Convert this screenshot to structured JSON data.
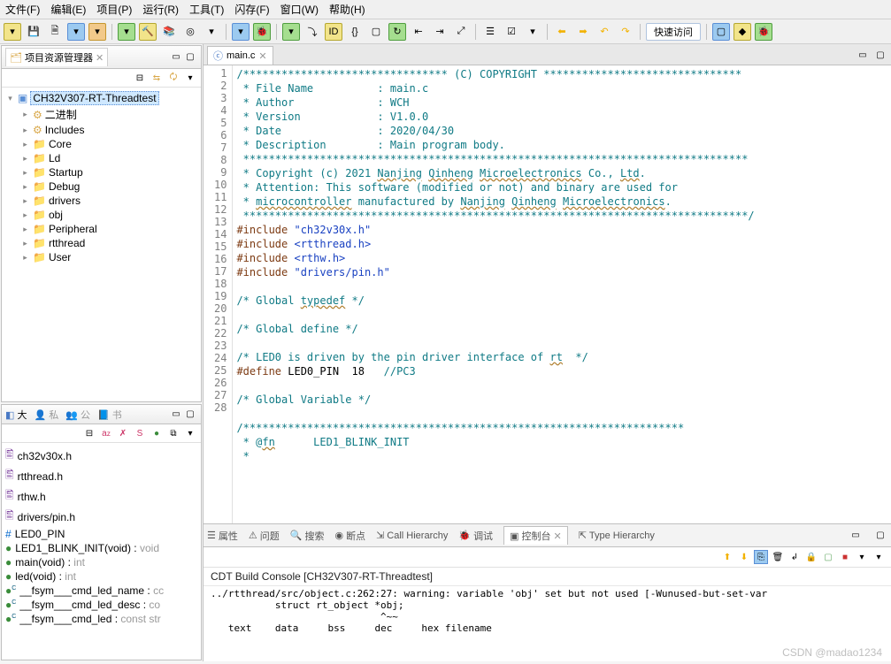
{
  "menubar": [
    "文件(F)",
    "编辑(E)",
    "项目(P)",
    "运行(R)",
    "工具(T)",
    "闪存(F)",
    "窗口(W)",
    "帮助(H)"
  ],
  "toolbar_fastaccess": "快速访问",
  "project_explorer": {
    "title": "项目资源管理器",
    "project_name": "CH32V307-RT-Threadtest",
    "folders": [
      "二进制",
      "Includes",
      "Core",
      "Ld",
      "Startup",
      "Debug",
      "drivers",
      "obj",
      "Peripheral",
      "rtthread",
      "User"
    ]
  },
  "outline_panel": {
    "tabs": [
      "大",
      "私",
      "公",
      "书"
    ],
    "items": [
      {
        "icon": "h",
        "label": "ch32v30x.h"
      },
      {
        "icon": "h",
        "label": "rtthread.h"
      },
      {
        "icon": "h",
        "label": "rthw.h"
      },
      {
        "icon": "h",
        "label": "drivers/pin.h"
      },
      {
        "icon": "#",
        "label": "LED0_PIN"
      },
      {
        "icon": "o",
        "label": "LED1_BLINK_INIT(void) : void",
        "dim": true
      },
      {
        "icon": "o",
        "label": "main(void) : int",
        "dim": true
      },
      {
        "icon": "o",
        "label": "led(void) : int",
        "dim": true
      },
      {
        "icon": "oc",
        "label": "__fsym___cmd_led_name : cc",
        "dim": true
      },
      {
        "icon": "oc",
        "label": "__fsym___cmd_led_desc : co",
        "dim": true
      },
      {
        "icon": "oc",
        "label": "__fsym___cmd_led : const str",
        "dim": true
      }
    ]
  },
  "editor": {
    "file_tab": "main.c",
    "lines": [
      {
        "n": 1,
        "html": "<span class='c-comment'>/******************************** (C) COPYRIGHT *******************************</span>"
      },
      {
        "n": 2,
        "html": "<span class='c-comment'> * File Name          : main.c</span>"
      },
      {
        "n": 3,
        "html": "<span class='c-comment'> * Author             : WCH</span>"
      },
      {
        "n": 4,
        "html": "<span class='c-comment'> * Version            : V1.0.0</span>"
      },
      {
        "n": 5,
        "html": "<span class='c-comment'> * Date               : 2020/04/30</span>"
      },
      {
        "n": 6,
        "html": "<span class='c-comment'> * Description        : Main program body.</span>"
      },
      {
        "n": 7,
        "html": "<span class='c-comment'> *******************************************************************************</span>"
      },
      {
        "n": 8,
        "html": "<span class='c-comment'> * Copyright (c) 2021 <span class='c-wavy'>Nanjing</span> <span class='c-wavy'>Qinheng</span> <span class='c-wavy'>Microelectronics</span> Co., <span class='c-wavy'>Ltd</span>.</span>"
      },
      {
        "n": 9,
        "html": "<span class='c-comment'> * Attention: This software (modified or not) and binary are used for</span>"
      },
      {
        "n": 10,
        "html": "<span class='c-comment'> * <span class='c-wavy'>microcontroller</span> manufactured by <span class='c-wavy'>Nanjing</span> <span class='c-wavy'>Qinheng</span> <span class='c-wavy'>Microelectronics</span>.</span>"
      },
      {
        "n": 11,
        "html": "<span class='c-comment'> *******************************************************************************/</span>"
      },
      {
        "n": 12,
        "html": "<span class='c-pp'>#include</span> <span class='c-str'>\"ch32v30x.h\"</span>"
      },
      {
        "n": 13,
        "html": "<span class='c-pp'>#include</span> <span class='c-str'>&lt;rtthread.h&gt;</span>"
      },
      {
        "n": 14,
        "html": "<span class='c-pp'>#include</span> <span class='c-str'>&lt;rthw.h&gt;</span>"
      },
      {
        "n": 15,
        "html": "<span class='c-pp'>#include</span> <span class='c-str'>\"drivers/pin.h\"</span>"
      },
      {
        "n": 16,
        "html": ""
      },
      {
        "n": 17,
        "html": "<span class='c-comment'>/* Global <span class='c-wavy'>typedef</span> */</span>"
      },
      {
        "n": 18,
        "html": ""
      },
      {
        "n": 19,
        "html": "<span class='c-comment'>/* Global define */</span>"
      },
      {
        "n": 20,
        "html": ""
      },
      {
        "n": 21,
        "html": "<span class='c-comment'>/* LED0 is driven by the pin driver interface of <span class='c-wavy'>rt</span>  */</span>"
      },
      {
        "n": 22,
        "html": "<span class='c-pp'>#define</span> LED0_PIN  18   <span class='c-comment'>//PC3</span>"
      },
      {
        "n": 23,
        "html": ""
      },
      {
        "n": 24,
        "html": "<span class='c-comment'>/* Global Variable */</span>"
      },
      {
        "n": 25,
        "html": ""
      },
      {
        "n": 26,
        "html": "<span class='c-comment'>/*********************************************************************</span>"
      },
      {
        "n": 27,
        "html": "<span class='c-comment'> * @<span class='c-wavy'>fn</span>      LED1_BLINK_INIT</span>"
      },
      {
        "n": 28,
        "html": "<span class='c-comment'> *</span>"
      }
    ]
  },
  "bottom": {
    "tabs": [
      "属性",
      "问题",
      "搜索",
      "断点",
      "Call Hierarchy",
      "调试",
      "控制台",
      "Type Hierarchy"
    ],
    "active_tab": "控制台",
    "title": "CDT Build Console [CH32V307-RT-Threadtest]",
    "console_text": "../rtthread/src/object.c:262:27: warning: variable 'obj' set but not used [-Wunused-but-set-var\n           struct rt_object *obj;\n                             ^~~\n   text\t   data\t    bss\t    dec\t    hex\tfilename"
  },
  "watermark": "CSDN @madao1234"
}
